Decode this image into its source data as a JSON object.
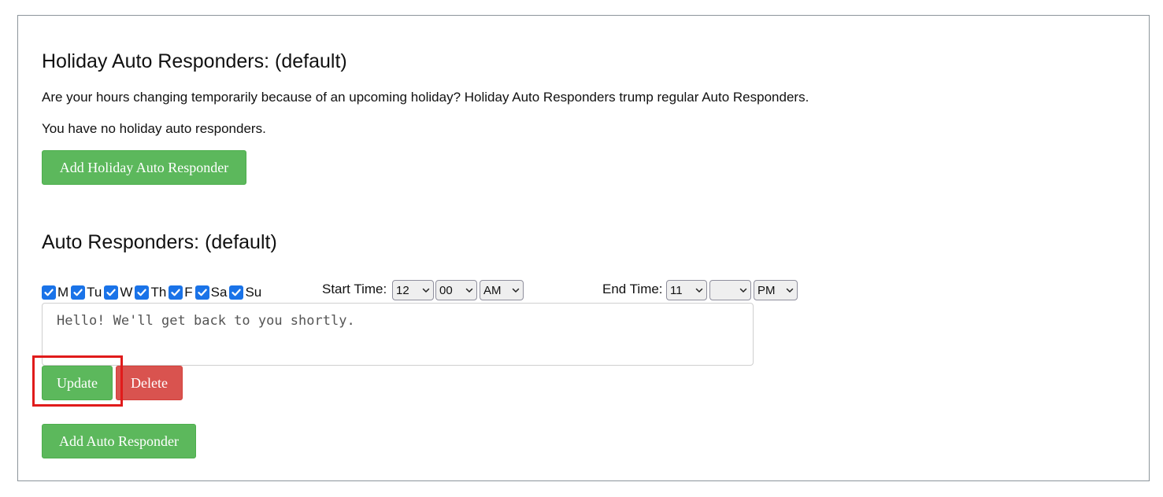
{
  "holiday": {
    "title": "Holiday Auto Responders: (default)",
    "description": "Are your hours changing temporarily because of an upcoming holiday? Holiday Auto Responders trump regular Auto Responders.",
    "empty_text": "You have no holiday auto responders.",
    "add_button": "Add Holiday Auto Responder"
  },
  "auto": {
    "title": "Auto Responders: (default)",
    "days": [
      {
        "label": "M",
        "checked": true
      },
      {
        "label": "Tu",
        "checked": true
      },
      {
        "label": "W",
        "checked": true
      },
      {
        "label": "Th",
        "checked": true
      },
      {
        "label": "F",
        "checked": true
      },
      {
        "label": "Sa",
        "checked": true
      },
      {
        "label": "Su",
        "checked": true
      }
    ],
    "start_label": "Start Time:",
    "start_hour": "12",
    "start_minute": "00",
    "start_period": "AM",
    "end_label": "End Time:",
    "end_hour": "11",
    "end_minute": "",
    "end_period": "PM",
    "message": "Hello! We'll get back to you shortly.",
    "update_button": "Update",
    "delete_button": "Delete",
    "add_button": "Add Auto Responder"
  },
  "colors": {
    "success": "#5cb85c",
    "danger": "#d9534f",
    "checkbox": "#1a73e8",
    "highlight": "#e01b1b"
  }
}
